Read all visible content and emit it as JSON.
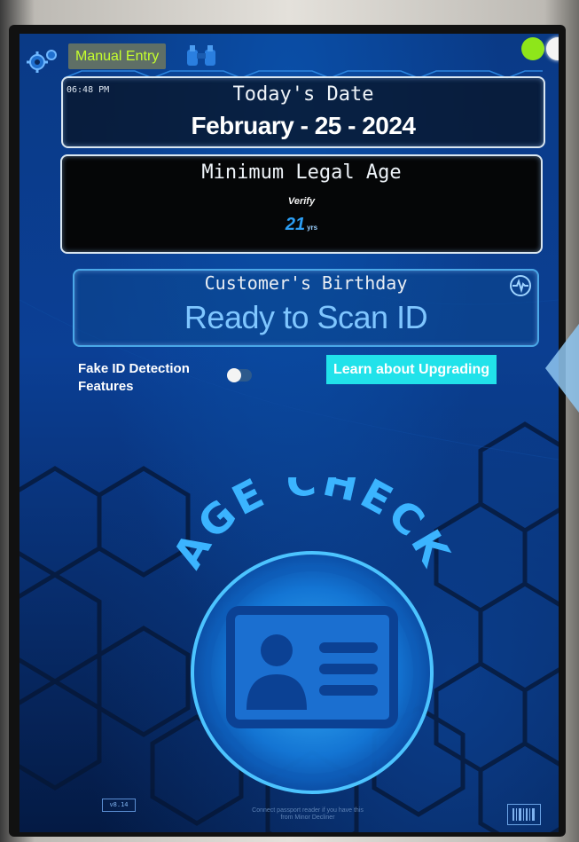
{
  "header": {
    "manual_entry_label": "Manual Entry",
    "settings_icon": "gear-icon",
    "search_icon": "binoculars-icon",
    "status_colors": [
      "#8ee61a",
      "#f4f4f4"
    ]
  },
  "date_panel": {
    "time": "06:48 PM",
    "title": "Today's Date",
    "date": "February - 25 - 2024"
  },
  "age_panel": {
    "title": "Minimum Legal Age",
    "verify_label": "Verify",
    "age_value": "21",
    "age_unit": "yrs"
  },
  "birthday_panel": {
    "title": "Customer's Birthday",
    "status": "Ready to Scan ID",
    "icon": "pulse-icon"
  },
  "features": {
    "fake_id_label_line1": "Fake ID Detection",
    "fake_id_label_line2": "Features",
    "toggle_state": "off",
    "upgrade_label": "Learn about Upgrading"
  },
  "logo": {
    "text": "AGE CHECK"
  },
  "footer": {
    "version": "v8.14",
    "passport_note_line1": "Connect passport reader if you have this",
    "passport_note_line2": "from Minor Decliner",
    "barcode_icon": "barcode-icon"
  },
  "colors": {
    "accent_green": "#c6ff2e",
    "accent_cyan": "#21e2ea",
    "scan_text": "#7fc6ff",
    "age_blue": "#2c9ff5"
  }
}
